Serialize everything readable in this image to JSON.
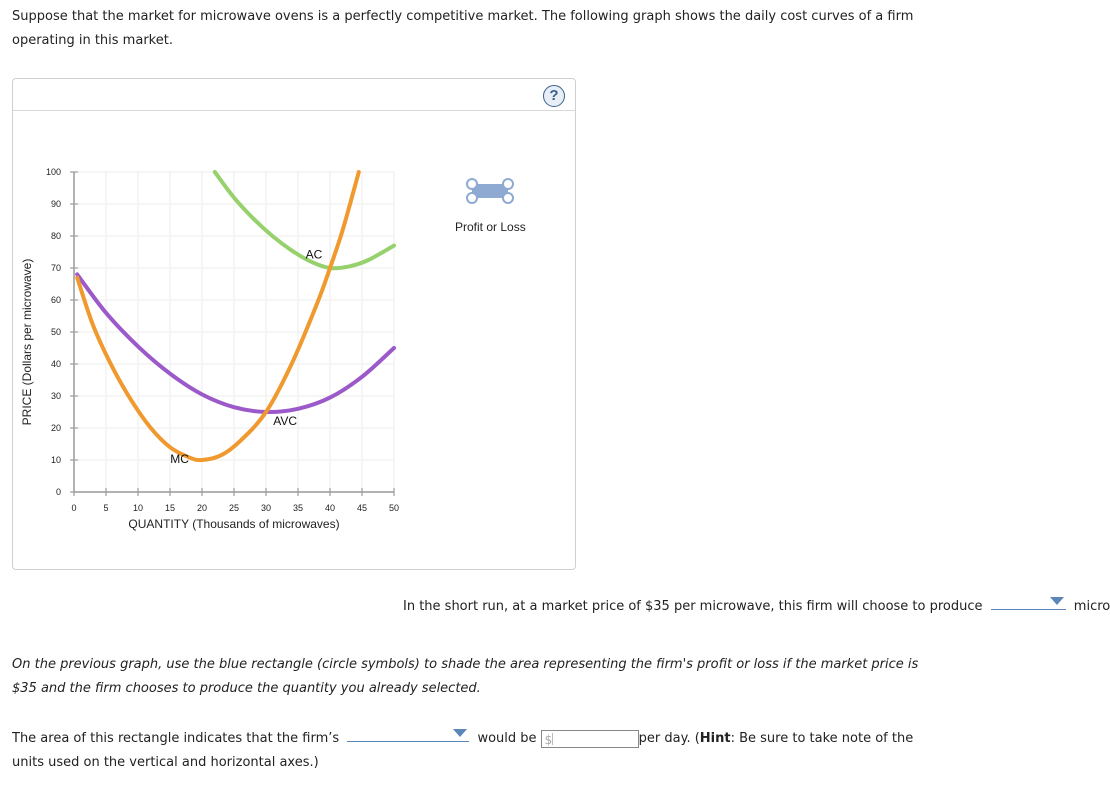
{
  "intro_text": "Suppose that the market for microwave ovens is a perfectly competitive market. The following graph shows the daily cost curves of a firm operating in this market.",
  "graph": {
    "help_icon": "question-mark-icon",
    "help_label": "?",
    "tool": {
      "icon": "rectangle-with-circle-handles-icon",
      "label": "Profit or Loss",
      "color": "#8eaad2"
    }
  },
  "chart_data": {
    "type": "line",
    "title": "",
    "xlabel": "QUANTITY (Thousands of microwaves)",
    "ylabel": "PRICE (Dollars per microwave)",
    "xlim": [
      0,
      50
    ],
    "ylim": [
      0,
      100
    ],
    "xticks": [
      0,
      5,
      10,
      15,
      20,
      25,
      30,
      35,
      40,
      45,
      50
    ],
    "yticks": [
      0,
      10,
      20,
      30,
      40,
      50,
      60,
      70,
      80,
      90,
      100
    ],
    "grid": true,
    "series": [
      {
        "name": "AC",
        "color": "#96d16d",
        "points": [
          [
            22,
            100
          ],
          [
            25,
            92
          ],
          [
            28,
            85.5
          ],
          [
            31,
            80
          ],
          [
            34,
            75.5
          ],
          [
            37,
            72
          ],
          [
            40,
            70
          ],
          [
            43,
            70.5
          ],
          [
            46,
            72.5
          ],
          [
            50,
            77
          ]
        ]
      },
      {
        "name": "AVC",
        "color": "#9b59c9",
        "points": [
          [
            0.5,
            68
          ],
          [
            5,
            56
          ],
          [
            10,
            45.5
          ],
          [
            15,
            37
          ],
          [
            20,
            30.5
          ],
          [
            25,
            26.5
          ],
          [
            30,
            25
          ],
          [
            35,
            26
          ],
          [
            40,
            29.5
          ],
          [
            45,
            36
          ],
          [
            50,
            45
          ]
        ]
      },
      {
        "name": "MC",
        "color": "#f0992f",
        "points": [
          [
            0.5,
            67
          ],
          [
            3,
            52
          ],
          [
            6,
            39
          ],
          [
            9,
            28.5
          ],
          [
            12,
            20
          ],
          [
            15,
            14
          ],
          [
            18,
            10.8
          ],
          [
            20,
            10
          ],
          [
            23,
            11.5
          ],
          [
            26,
            16
          ],
          [
            30,
            25
          ],
          [
            34,
            40
          ],
          [
            38,
            59
          ],
          [
            40,
            70
          ],
          [
            42,
            82
          ],
          [
            44.5,
            100
          ]
        ]
      }
    ],
    "labels": [
      {
        "text": "AC",
        "x": 37.5,
        "y": 73
      },
      {
        "text": "AVC",
        "x": 33,
        "y": 21
      },
      {
        "text": "MC",
        "x": 16.5,
        "y": 9
      }
    ]
  },
  "q1": {
    "before": "In the short run, at a market price of $35 per microwave, this firm will choose to produce",
    "dropdown_value": "",
    "after": "microwaves per day."
  },
  "q2": "On the previous graph, use the blue rectangle (circle symbols) to shade the area representing the firm's profit or loss if the market price is $35 and the firm chooses to produce the quantity you already selected.",
  "q3": {
    "before": "The area of this rectangle indicates that the firm’s",
    "dropdown_value": "",
    "middle": "would be",
    "input_prefix": "$",
    "input_value": "",
    "after_1": "per day. (",
    "hint_label": "Hint",
    "after_2": ": Be sure to take note of the units used on the vertical and horizontal axes.)"
  }
}
